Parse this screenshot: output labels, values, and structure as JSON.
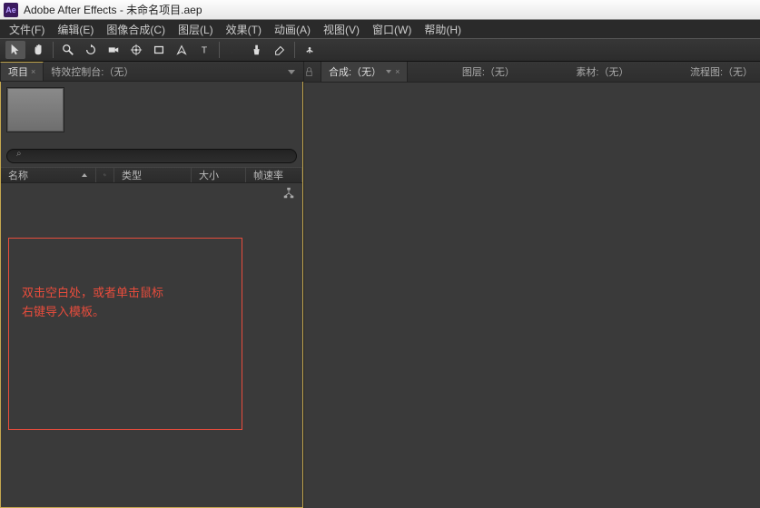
{
  "titlebar": {
    "app_icon_text": "Ae",
    "title": "Adobe After Effects - 未命名项目.aep"
  },
  "menubar": {
    "items": [
      "文件(F)",
      "编辑(E)",
      "图像合成(C)",
      "图层(L)",
      "效果(T)",
      "动画(A)",
      "视图(V)",
      "窗口(W)",
      "帮助(H)"
    ]
  },
  "toolbar": {
    "tools": [
      "selection",
      "hand",
      "zoom",
      "rotate",
      "camera",
      "pan-behind",
      "rect",
      "pen",
      "text",
      "brush",
      "clone",
      "eraser",
      "puppet"
    ]
  },
  "left_panel": {
    "tabs": {
      "project": "项目",
      "effects_console": "特效控制台:（无）"
    },
    "search_placeholder": "",
    "search_icon": "⌕",
    "columns": {
      "name": "名称",
      "tag": "",
      "type": "类型",
      "size": "大小",
      "rate": "帧速率"
    },
    "hint_line1": "双击空白处，或者单击鼠标",
    "hint_line2": "右键导入模板。"
  },
  "right_panel": {
    "tabs": {
      "comp": "合成:（无）",
      "layer": "图层:（无）",
      "footage": "素材:（无）",
      "flowchart": "流程图:（无）"
    }
  }
}
